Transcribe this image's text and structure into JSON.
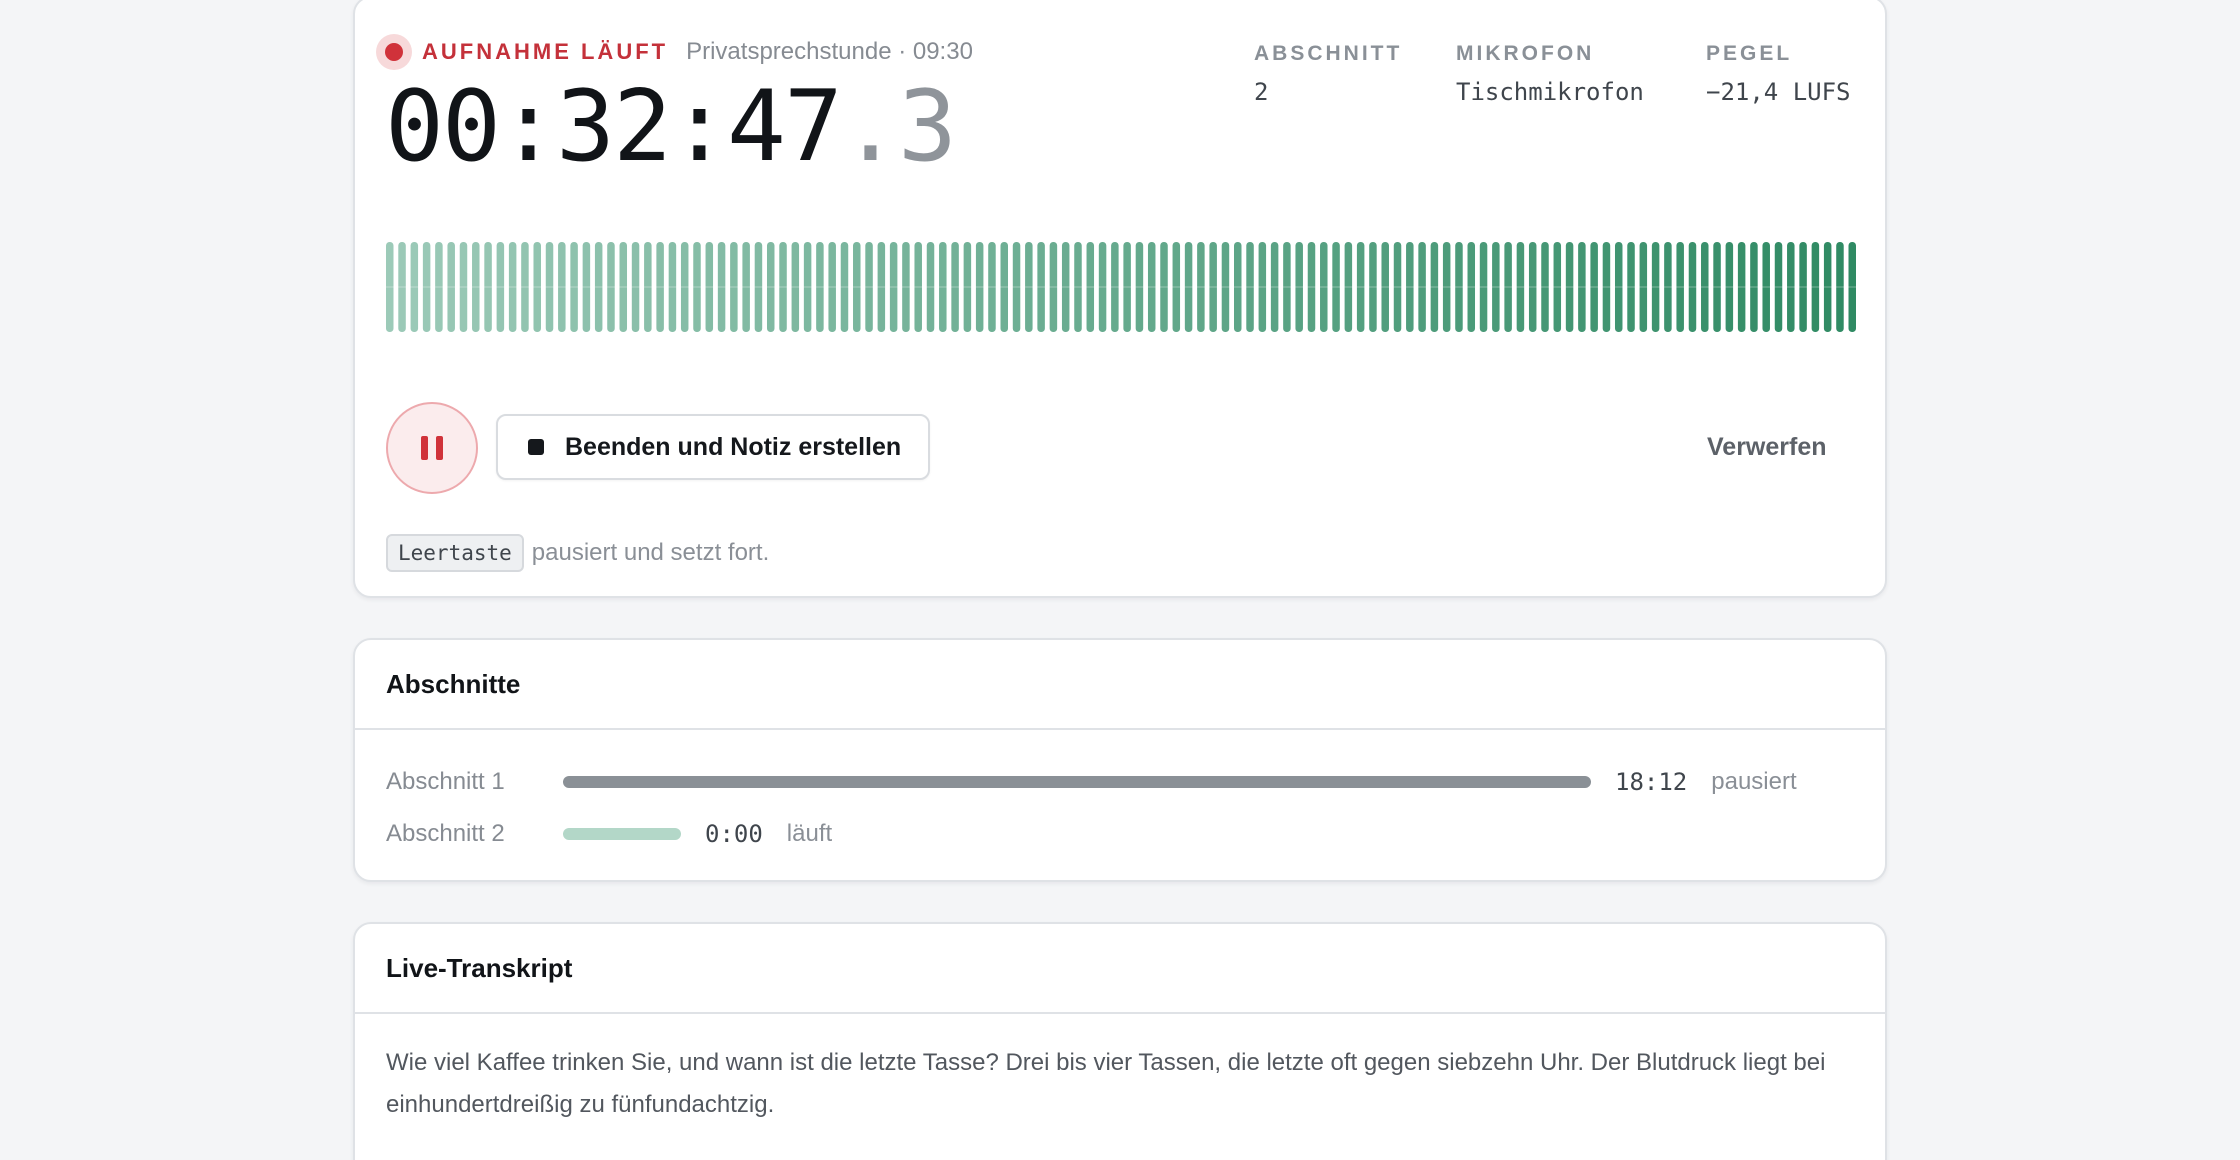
{
  "recording": {
    "status": "AUFNAHME LÄUFT",
    "session": "Privatsprechstunde · 09:30",
    "timer_main": "00:32:47",
    "timer_tenth": ".3",
    "meta": [
      {
        "key": "ABSCHNITT",
        "value": "2"
      },
      {
        "key": "MIKROFON",
        "value": "Tischmikrofon"
      },
      {
        "key": "PEGEL",
        "value": "−21,4 LUFS"
      }
    ],
    "controls": {
      "pause_label": "pause",
      "stop_label": "Beenden und Notiz erstellen",
      "discard_label": "Verwerfen"
    },
    "hint": {
      "key": "Leertaste",
      "text": "pausiert und setzt fort."
    },
    "colors": {
      "accent": "#d0323a",
      "wave_light": "#9ccab8",
      "wave_dark": "#2f8a63"
    }
  },
  "segments": {
    "title": "Abschnitte",
    "items": [
      {
        "name": "Abschnitt 1",
        "time": "18:12",
        "state": "pausiert",
        "color": "#8a9096"
      },
      {
        "name": "Abschnitt 2",
        "time": "0:00",
        "state": "läuft",
        "color": "#b3d7c8"
      }
    ]
  },
  "transcript": {
    "title": "Live-Transkript",
    "text": "Wie viel Kaffee trinken Sie, und wann ist die letzte Tasse? Drei bis vier Tassen, die letzte oft gegen siebzehn Uhr. Der Blutdruck liegt bei einhundertdreißig zu fünfundachtzig."
  }
}
